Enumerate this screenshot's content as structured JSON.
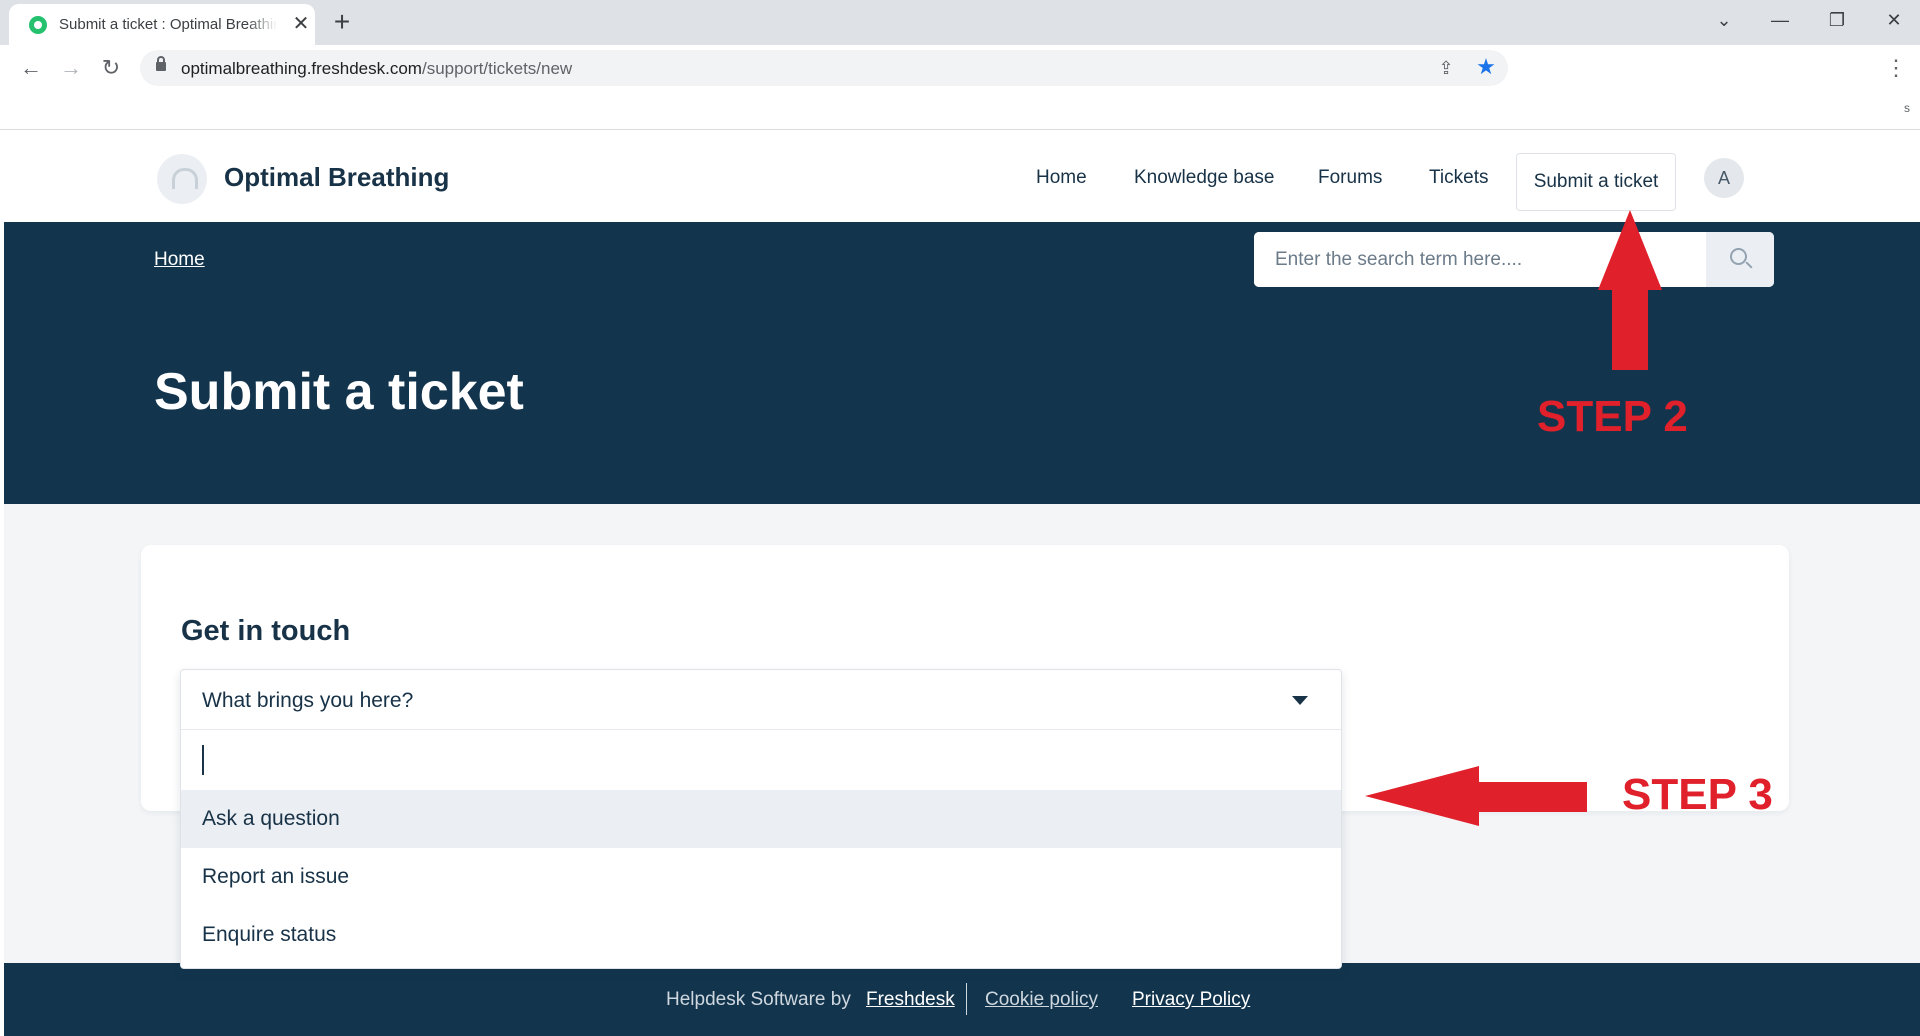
{
  "browser": {
    "tab_title": "Submit a ticket : Optimal Breathing",
    "tab_close": "✕",
    "new_tab": "+",
    "win_chevron": "⌄",
    "win_min": "—",
    "win_restore": "❐",
    "win_close": "✕",
    "url_host": "optimalbreathing.freshdesk.com",
    "url_path": "/support/tickets/new",
    "bookmark_fragment": "s"
  },
  "header": {
    "brand": "Optimal Breathing",
    "nav": [
      "Home",
      "Knowledge base",
      "Forums",
      "Tickets",
      "Submit a ticket"
    ],
    "avatar_initial": "A"
  },
  "hero": {
    "breadcrumb": "Home",
    "search_placeholder": "Enter the search term here....",
    "title": "Submit a ticket"
  },
  "form": {
    "heading": "Get in touch",
    "dropdown_label": "What brings you here?",
    "options": [
      "Ask a question",
      "Report an issue",
      "Enquire status"
    ],
    "highlighted_option": 0
  },
  "footer": {
    "prefix": "Helpdesk Software by",
    "freshdesk": "Freshdesk",
    "cookie": "Cookie policy",
    "privacy": "Privacy Policy"
  },
  "annotations": {
    "step2": "STEP 2",
    "step3": "STEP 3",
    "color": "#e0202a"
  },
  "colors": {
    "hero_bg": "#12344d",
    "text_primary": "#183247",
    "page_bg": "#f3f5f7"
  }
}
